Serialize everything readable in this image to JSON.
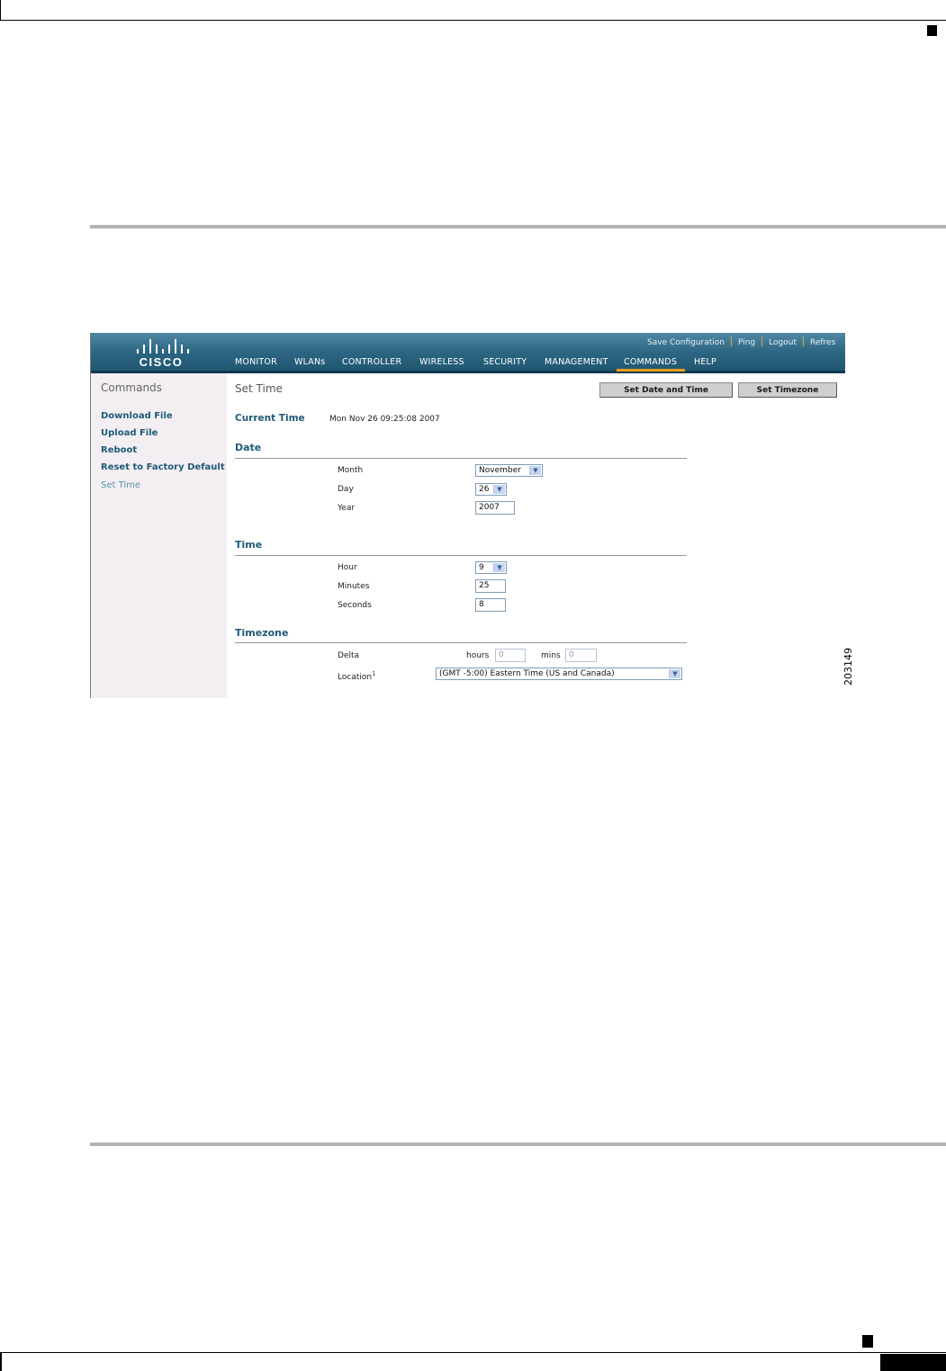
{
  "figure_id": "203149",
  "header": {
    "logo_text": "CISCO",
    "top_links": [
      "Save Configuration",
      "Ping",
      "Logout",
      "Refres"
    ],
    "nav": [
      "MONITOR",
      "WLANs",
      "CONTROLLER",
      "WIRELESS",
      "SECURITY",
      "MANAGEMENT",
      "COMMANDS",
      "HELP"
    ],
    "active_nav": "COMMANDS",
    "accent_color": "#f09d1b"
  },
  "sidebar": {
    "title": "Commands",
    "items": [
      "Download File",
      "Upload File",
      "Reboot",
      "Reset to Factory Default",
      "Set Time"
    ],
    "current": "Set Time"
  },
  "main": {
    "title": "Set Time",
    "buttons": {
      "set_date_time": "Set Date and Time",
      "set_timezone": "Set Timezone"
    },
    "current_time_label": "Current Time",
    "current_time_value": "Mon Nov 26 09:25:08 2007",
    "date": {
      "heading": "Date",
      "month_label": "Month",
      "month_value": "November",
      "day_label": "Day",
      "day_value": "26",
      "year_label": "Year",
      "year_value": "2007"
    },
    "time": {
      "heading": "Time",
      "hour_label": "Hour",
      "hour_value": "9",
      "minutes_label": "Minutes",
      "minutes_value": "25",
      "seconds_label": "Seconds",
      "seconds_value": "8"
    },
    "timezone": {
      "heading": "Timezone",
      "delta_label": "Delta",
      "hours_label": "hours",
      "hours_value": "0",
      "mins_label": "mins",
      "mins_value": "0",
      "location_label": "Location",
      "location_footnote": "1",
      "location_value": "(GMT -5:00) Eastern Time (US and Canada)"
    }
  }
}
